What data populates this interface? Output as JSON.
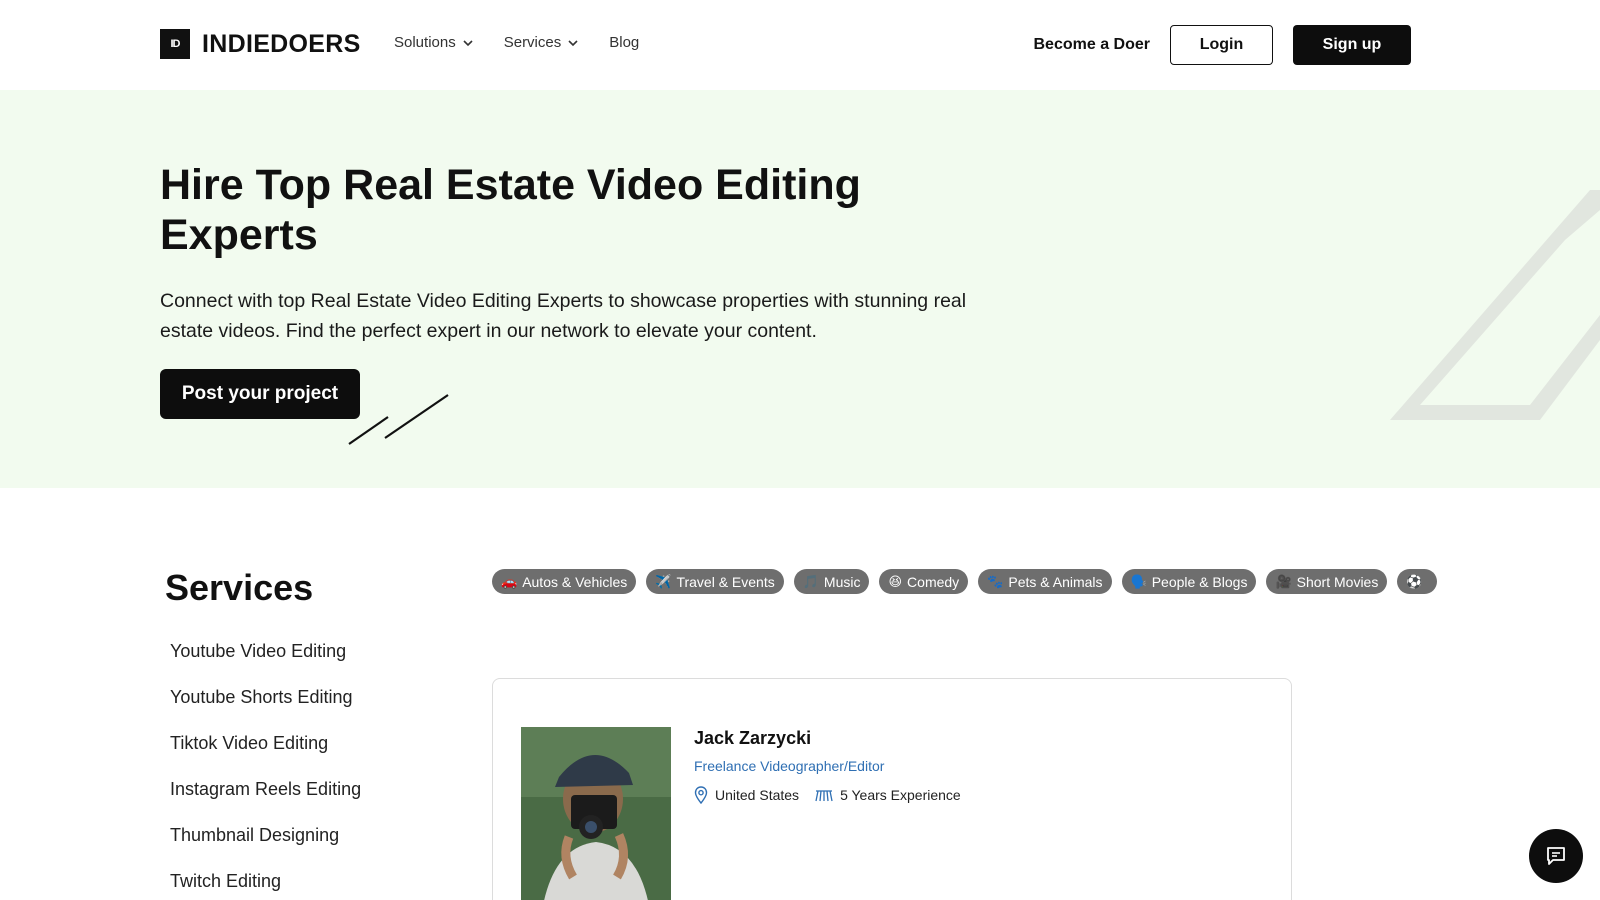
{
  "header": {
    "logo_mark": "ID",
    "logo_text": "INDIEDOERS",
    "nav": [
      {
        "label": "Solutions",
        "has_dropdown": true
      },
      {
        "label": "Services",
        "has_dropdown": true
      },
      {
        "label": "Blog",
        "has_dropdown": false
      }
    ],
    "become_label": "Become a Doer",
    "login_label": "Login",
    "signup_label": "Sign up"
  },
  "hero": {
    "title": "Hire Top Real Estate Video Editing Experts",
    "description": "Connect with top Real Estate Video Editing Experts to showcase properties with stunning real estate videos. Find the perfect expert in our network to elevate your content.",
    "cta_label": "Post your project",
    "background_color": "#f2fbef"
  },
  "services": {
    "title": "Services",
    "items": [
      "Youtube Video Editing",
      "Youtube Shorts Editing",
      "Tiktok Video Editing",
      "Instagram Reels Editing",
      "Thumbnail Designing",
      "Twitch Editing"
    ]
  },
  "chips": [
    {
      "emoji": "🚗",
      "label": "Autos & Vehicles"
    },
    {
      "emoji": "✈️",
      "label": "Travel & Events"
    },
    {
      "emoji": "🎵",
      "label": "Music"
    },
    {
      "emoji": "😆",
      "label": "Comedy"
    },
    {
      "emoji": "🐾",
      "label": "Pets & Animals"
    },
    {
      "emoji": "🗣️",
      "label": "People & Blogs"
    },
    {
      "emoji": "🎥",
      "label": "Short Movies"
    },
    {
      "emoji": "⚽",
      "label": ""
    }
  ],
  "profile": {
    "name": "Jack Zarzycki",
    "role": "Freelance Videographer/Editor",
    "location": "United States",
    "experience": "5 Years Experience",
    "location_icon": "map-pin-icon",
    "experience_icon": "experience-icon"
  },
  "chat": {
    "icon": "chat-icon"
  },
  "colors": {
    "accent": "#0d0d0d",
    "link": "#2f6fb3",
    "chip": "#6e6e6e"
  }
}
